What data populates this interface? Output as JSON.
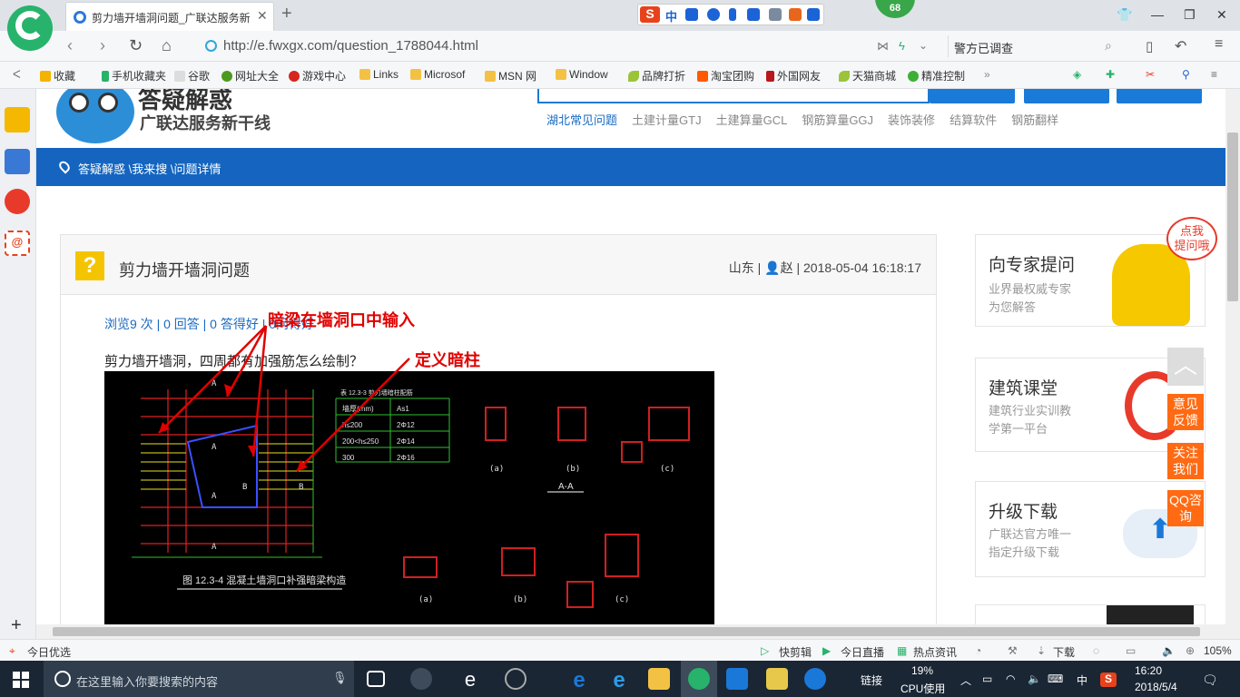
{
  "browser": {
    "tab_title": "剪力墙开墙洞问题_广联达服务新",
    "url": "http://e.fwxgx.com/question_1788044.html",
    "search_placeholder": "警方已调查",
    "ime_label": "中",
    "badge_count": "68"
  },
  "bookmarks": [
    {
      "label": "收藏",
      "icon": "star-icon"
    },
    {
      "label": "手机收藏夹",
      "icon": "phone-icon"
    },
    {
      "label": "谷歌",
      "icon": "page-icon"
    },
    {
      "label": "网址大全",
      "icon": "globe-icon"
    },
    {
      "label": "游戏中心",
      "icon": "game-icon"
    },
    {
      "label": "Links",
      "icon": "folder-icon"
    },
    {
      "label": "Microsof",
      "icon": "folder-icon"
    },
    {
      "label": "MSN 网",
      "icon": "folder-icon"
    },
    {
      "label": "Window",
      "icon": "folder-icon"
    },
    {
      "label": "品牌打折",
      "icon": "leaf-icon"
    },
    {
      "label": "淘宝团购",
      "icon": "taobao-icon"
    },
    {
      "label": "外国网友",
      "icon": "bookmark-icon"
    },
    {
      "label": "天猫商城",
      "icon": "leaf-icon"
    },
    {
      "label": "精准控制",
      "icon": "wechat-icon"
    }
  ],
  "site": {
    "brand_title": "答疑解惑",
    "brand_sub": "广联达服务新干线",
    "hot_links": [
      "湖北常见问题",
      "土建计量GTJ",
      "土建算量GCL",
      "钢筋算量GGJ",
      "装饰装修",
      "结算软件",
      "钢筋翻样"
    ],
    "breadcrumb": "答疑解惑 \\我来搜 \\问题详情"
  },
  "question": {
    "title": "剪力墙开墙洞问题",
    "region": "山东",
    "user": "赵",
    "datetime": "2018-05-04 16:18:17",
    "stats": "浏览9 次 | 0 回答 | 0 答得好 | 0问得好",
    "body": "剪力墙开墙洞，四周都有加强筋怎么绘制？",
    "annotation_1": "暗梁在墙洞口中输入",
    "annotation_2": "定义暗柱",
    "cad_caption": "图 12.3-4  混凝土墙洞口补强暗梁构造",
    "cad_table_title": "表 12.3-3  剪力墙暗柱配筋",
    "cad_table_header": [
      "墙厚(mm)",
      "As1"
    ],
    "cad_table_rows": [
      [
        "h≤200",
        "2Φ12"
      ],
      [
        "200<h≤250",
        "2Φ14"
      ],
      [
        "300",
        "2Φ16"
      ]
    ],
    "cad_section": "A-A"
  },
  "sidebar_cards": [
    {
      "title": "向专家提问",
      "sub1": "业界最权威专家",
      "sub2": "为您解答",
      "bubble": "点我\n提问哦"
    },
    {
      "title": "建筑课堂",
      "sub1": "建筑行业实训教",
      "sub2": "学第一平台"
    },
    {
      "title": "升级下载",
      "sub1": "广联达官方唯一",
      "sub2": "指定升级下载"
    }
  ],
  "float_buttons": [
    "意见反馈",
    "关注我们",
    "QQ咨询"
  ],
  "status_bar": {
    "left": "今日优选",
    "items": [
      "快剪辑",
      "今日直播",
      "热点资讯",
      "下载"
    ],
    "zoom": "105%"
  },
  "taskbar": {
    "search_placeholder": "在这里输入你要搜索的内容",
    "link_label": "链接",
    "cpu_percent": "19%",
    "cpu_label": "CPU使用",
    "ime": "中",
    "time": "16:20",
    "date": "2018/5/4"
  },
  "colors": {
    "brand_blue": "#1565c0",
    "accent_orange": "#ff6a13",
    "browser_green": "#27b36b",
    "annotation_red": "#e00000"
  }
}
